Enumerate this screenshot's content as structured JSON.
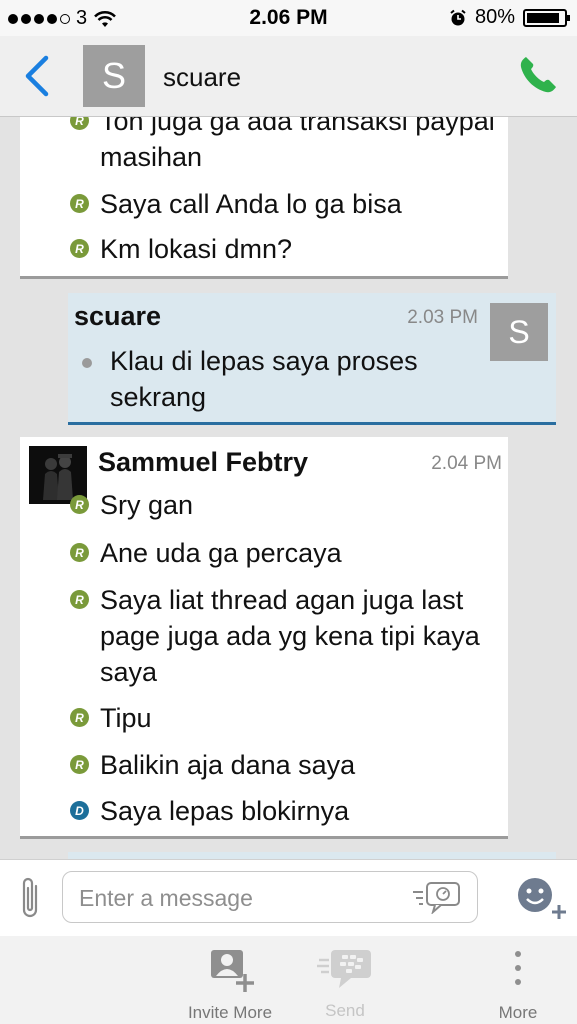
{
  "status_bar": {
    "carrier": "3",
    "time": "2.06 PM",
    "battery": "80%",
    "battery_level": 0.8
  },
  "header": {
    "avatar_letter": "S",
    "title": "scuare"
  },
  "messages": [
    {
      "lines": [
        {
          "badge": "R",
          "text": "Toh juga ga ada transaksi paypal masihan"
        },
        {
          "badge": "R",
          "text": "Saya call Anda lo ga bisa"
        },
        {
          "badge": "R",
          "text": "Km lokasi dmn?"
        }
      ]
    },
    {
      "sender": "scuare",
      "time": "2.03 PM",
      "avatar_letter": "S",
      "lines": [
        {
          "badge": "",
          "text": "Klau di lepas saya proses sekrang"
        }
      ]
    },
    {
      "sender": "Sammuel Febtry",
      "time": "2.04 PM",
      "lines": [
        {
          "badge": "R",
          "text": "Sry gan"
        },
        {
          "badge": "R",
          "text": "Ane uda ga percaya"
        },
        {
          "badge": "R",
          "text": "Saya liat thread agan juga last page juga ada yg kena tipi kaya saya"
        },
        {
          "badge": "R",
          "text": "Tipu"
        },
        {
          "badge": "R",
          "text": "Balikin aja dana saya"
        },
        {
          "badge": "D",
          "text": "Saya lepas blokirnya"
        }
      ]
    }
  ],
  "composer": {
    "placeholder": "Enter a message"
  },
  "bottom_bar": {
    "invite_label": "Invite More",
    "send_label": "Send",
    "more_label": "More"
  },
  "colors": {
    "accent_blue": "#1a7fe0",
    "call_green": "#2fb24c",
    "read_badge": "#7a9a3a",
    "delivered_badge": "#1c6f9a"
  }
}
